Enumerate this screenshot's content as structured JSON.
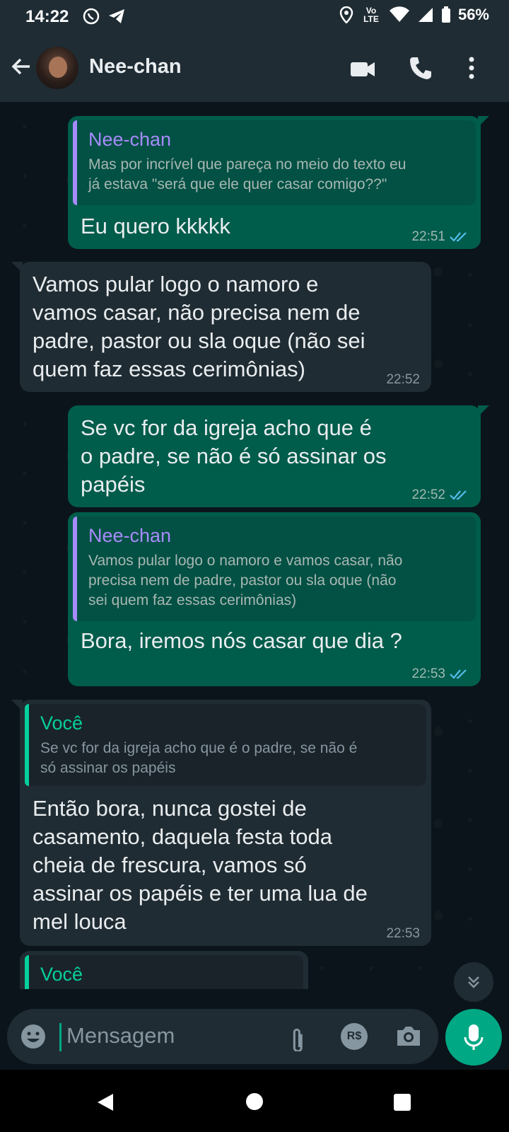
{
  "status_bar": {
    "time": "14:22",
    "battery": "56%",
    "lte": "Vo LTE"
  },
  "header": {
    "contact_name": "Nee-chan"
  },
  "messages": [
    {
      "dir": "out",
      "quote_name": "Nee-chan",
      "quote_lines": [
        "Mas por incrível que pareça no meio do texto eu",
        "já estava \"será que ele quer casar comigo??\""
      ],
      "lines": [
        "Eu quero kkkkk"
      ],
      "time": "22:51"
    },
    {
      "dir": "in",
      "lines": [
        "Vamos pular logo o namoro e",
        "vamos casar, não precisa nem de",
        "padre, pastor ou sla oque (não sei",
        "quem faz essas cerimônias)"
      ],
      "time": "22:52"
    },
    {
      "dir": "out",
      "lines": [
        "Se vc for da igreja acho que é",
        "o padre, se não é só assinar os",
        "papéis"
      ],
      "time": "22:52"
    },
    {
      "dir": "out",
      "quote_name": "Nee-chan",
      "quote_lines": [
        "Vamos pular logo o namoro e vamos casar, não",
        "precisa nem de padre, pastor ou sla oque (não",
        "sei quem faz essas cerimônias)"
      ],
      "lines": [
        "Bora, iremos nós casar que dia ?"
      ],
      "time": "22:53"
    },
    {
      "dir": "in",
      "quote_name": "Você",
      "quote_lines": [
        "Se vc for da igreja acho que é o padre, se não é",
        "só assinar os papéis"
      ],
      "lines": [
        "Então bora, nunca gostei de",
        "casamento, daquela festa toda",
        "cheia de frescura, vamos só",
        "assinar os papéis e ter uma lua de",
        "mel louca"
      ],
      "time": "22:53"
    },
    {
      "dir": "in",
      "quote_name": "Você"
    }
  ],
  "composer": {
    "placeholder": "Mensagem",
    "pix_label": "R$"
  },
  "colors": {
    "outgoing": "#005c4b",
    "incoming": "#202c33",
    "accent": "#00a884",
    "quote_name_nee": "#a78bfa",
    "quote_name_voce": "#06cf9c",
    "read_tick": "#53bdeb"
  }
}
